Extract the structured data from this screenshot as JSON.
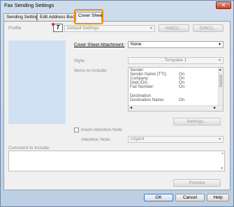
{
  "window": {
    "title": "Fax Sending Settings",
    "close_glyph": "✕"
  },
  "tabs": [
    {
      "label": "Sending Settings"
    },
    {
      "label": "Edit Address Book"
    },
    {
      "label": "Cover Sheet"
    }
  ],
  "profile": {
    "label": "Profile",
    "value": "Default Settings",
    "icon_glyph": "T",
    "add_button": "Add(1)...",
    "edit_button": "Edit(2)..."
  },
  "cover_sheet": {
    "attachment_label": "Cover Sheet Attachment:",
    "attachment_value": "None",
    "style_label": "Style:",
    "style_value": "Template 1",
    "items_label": "Items to Include:",
    "items": [
      {
        "name": "Sender",
        "value": ""
      },
      {
        "name": "Sender Name (TTI):",
        "value": "On"
      },
      {
        "name": "Company:",
        "value": "On"
      },
      {
        "name": "Dept./Div.:",
        "value": "On"
      },
      {
        "name": "Fax Number:",
        "value": "On"
      },
      {
        "name": "",
        "value": ""
      },
      {
        "name": "Destination",
        "value": ""
      },
      {
        "name": "Destination Name:",
        "value": "On"
      }
    ],
    "settings_button": "Settings...",
    "insert_attention_label": "Insert Attention Note",
    "attention_label": "Attention Note:",
    "attention_value": "Urgent",
    "comment_label": "Comment to Include:",
    "preview_button": "Preview"
  },
  "footer": {
    "ok": "OK",
    "cancel": "Cancel",
    "help": "Help"
  },
  "glyphs": {
    "down_arrow": "▼",
    "left_arrow": "◂",
    "right_arrow": "▸",
    "up_arrow": "▴"
  }
}
